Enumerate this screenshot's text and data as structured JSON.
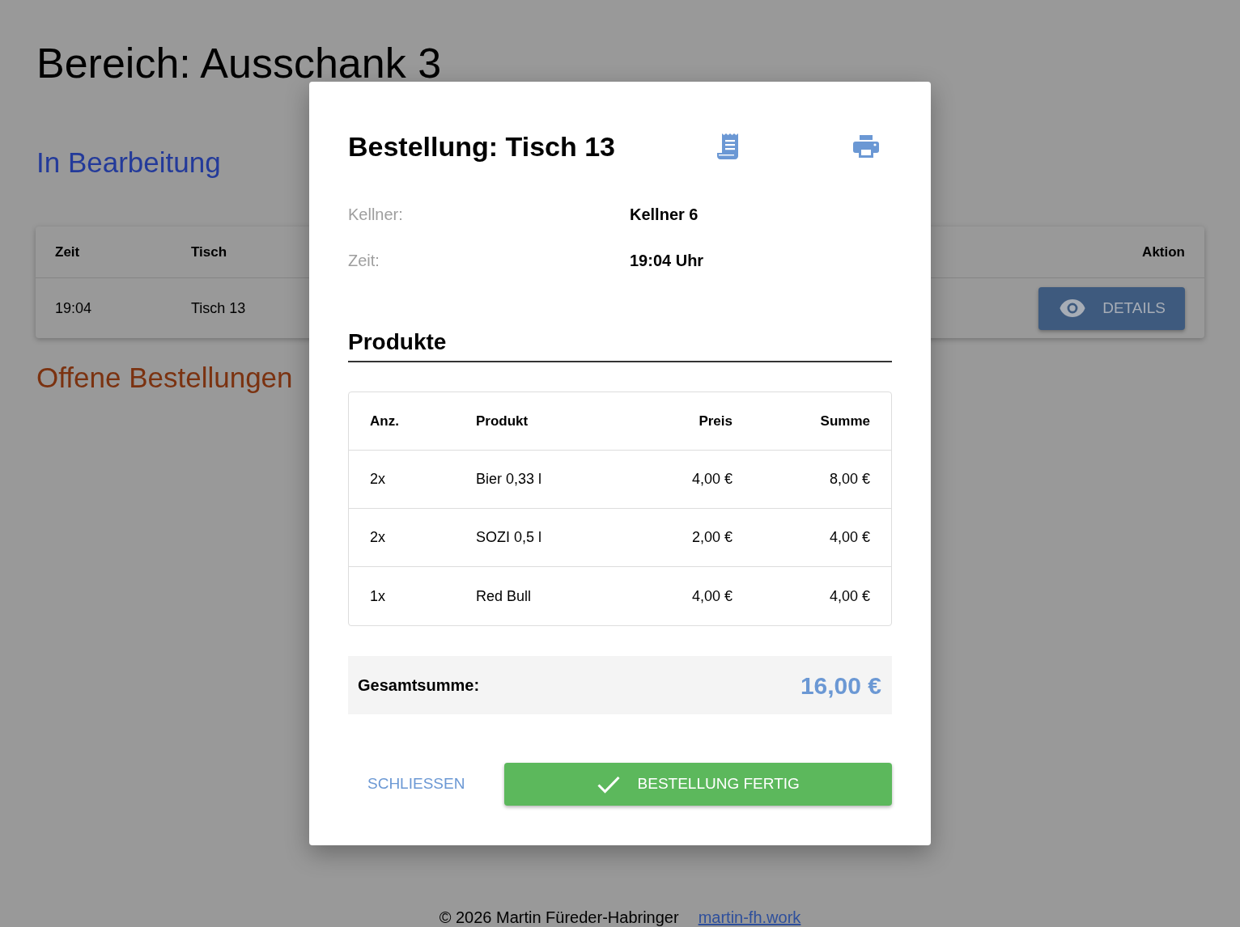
{
  "page": {
    "title": "Bereich: Ausschank 3"
  },
  "in_progress": {
    "heading": "In Bearbeitung",
    "columns": [
      "Zeit",
      "Tisch",
      "Aktion"
    ],
    "rows": [
      {
        "cells": [
          "19:04",
          "Tisch 13"
        ],
        "action": "DETAILS"
      }
    ]
  },
  "open_orders": {
    "heading": "Offene Bestellungen"
  },
  "dialog": {
    "title": "Bestellung: Tisch 13",
    "fields": [
      {
        "label": "Kellner:",
        "value": "Kellner 6"
      },
      {
        "label": "Zeit:",
        "value": "19:04 Uhr"
      }
    ],
    "products_heading": "Produkte",
    "table": {
      "columns": [
        "Anz.",
        "Produkt",
        "Preis",
        "Summe"
      ],
      "rows": [
        [
          "2x",
          "Bier 0,33 l",
          "4,00 €",
          "8,00 €"
        ],
        [
          "2x",
          "SOZI 0,5 l",
          "2,00 €",
          "4,00 €"
        ],
        [
          "1x",
          "Red Bull",
          "4,00 €",
          "4,00 €"
        ]
      ]
    },
    "total": {
      "label": "Gesamtsumme:",
      "value": "16,00 €"
    },
    "buttons": [
      {
        "label": "SCHLIESSEN",
        "kind": "text"
      },
      {
        "label": "BESTELLUNG FERTIG",
        "kind": "primary"
      }
    ]
  },
  "footer": {
    "text": "© 2026 Martin Füreder-Habringer",
    "link": "martin-fh.work"
  }
}
